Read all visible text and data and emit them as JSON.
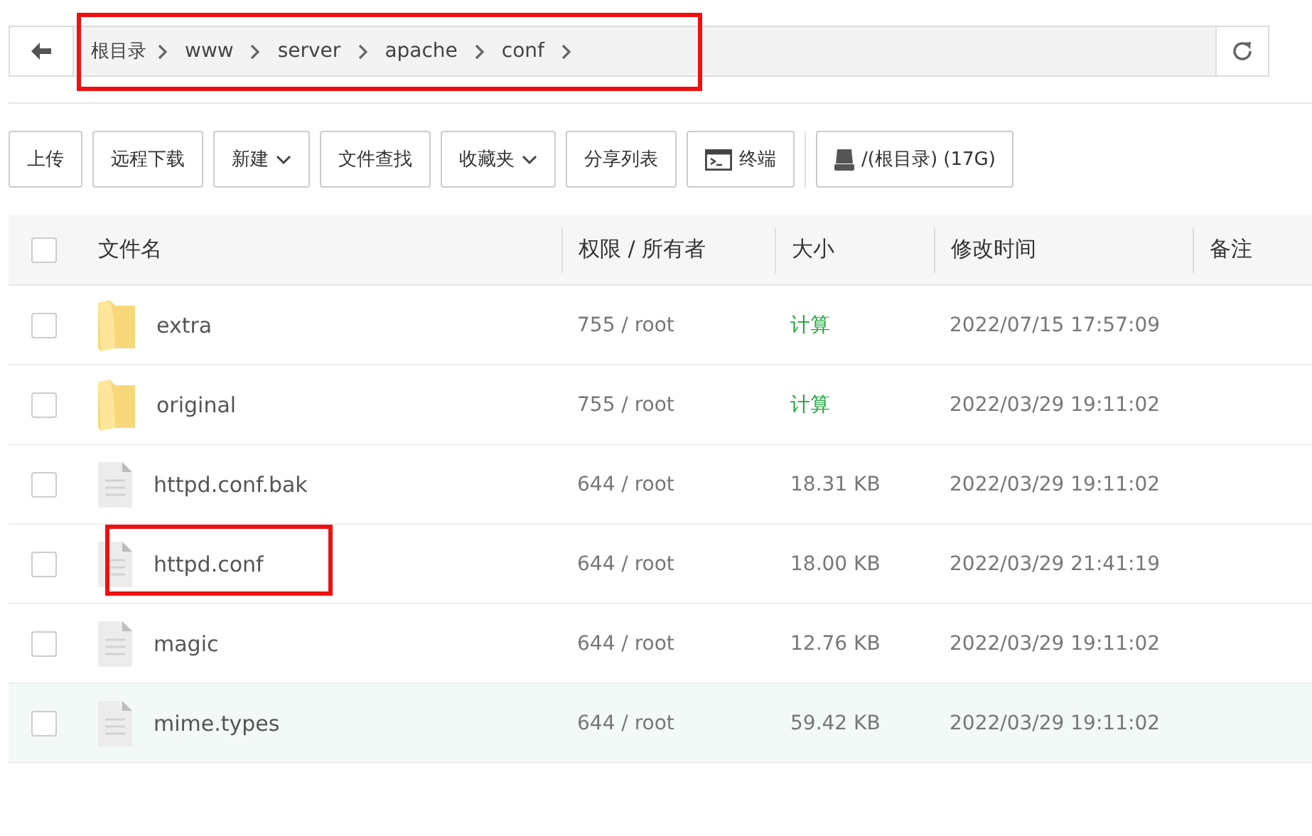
{
  "breadcrumb": {
    "highlighted": true,
    "items": [
      "根目录",
      "www",
      "server",
      "apache",
      "conf"
    ]
  },
  "toolbar": [
    {
      "label": "上传",
      "kind": "plain"
    },
    {
      "label": "远程下载",
      "kind": "plain"
    },
    {
      "label": "新建",
      "kind": "dropdown"
    },
    {
      "label": "文件查找",
      "kind": "plain"
    },
    {
      "label": "收藏夹",
      "kind": "dropdown"
    },
    {
      "label": "分享列表",
      "kind": "plain"
    },
    {
      "label": "终端",
      "kind": "terminal"
    },
    {
      "label": "/(根目录) (17G)",
      "kind": "disk"
    }
  ],
  "table": {
    "all_checked": false,
    "columns": [
      "文件名",
      "权限 / 所有者",
      "大小",
      "修改时间",
      "备注"
    ],
    "rows": [
      {
        "kind": "folder",
        "name": "extra",
        "perm": "755 / root",
        "size": "计算",
        "mtime": "2022/07/15 17:57:09",
        "checked": false,
        "hovered": false,
        "highlighted": false
      },
      {
        "kind": "folder",
        "name": "original",
        "perm": "755 / root",
        "size": "计算",
        "mtime": "2022/03/29 19:11:02",
        "checked": false,
        "hovered": false,
        "highlighted": false
      },
      {
        "kind": "file",
        "name": "httpd.conf.bak",
        "perm": "644 / root",
        "size": "18.31 KB",
        "mtime": "2022/03/29 19:11:02",
        "checked": false,
        "hovered": false,
        "highlighted": false
      },
      {
        "kind": "file",
        "name": "httpd.conf",
        "perm": "644 / root",
        "size": "18.00 KB",
        "mtime": "2022/03/29 21:41:19",
        "checked": false,
        "hovered": false,
        "highlighted": true
      },
      {
        "kind": "file",
        "name": "magic",
        "perm": "644 / root",
        "size": "12.76 KB",
        "mtime": "2022/03/29 19:11:02",
        "checked": false,
        "hovered": false,
        "highlighted": false
      },
      {
        "kind": "file",
        "name": "mime.types",
        "perm": "644 / root",
        "size": "59.42 KB",
        "mtime": "2022/03/29 19:11:02",
        "checked": false,
        "hovered": true,
        "highlighted": false
      }
    ]
  }
}
